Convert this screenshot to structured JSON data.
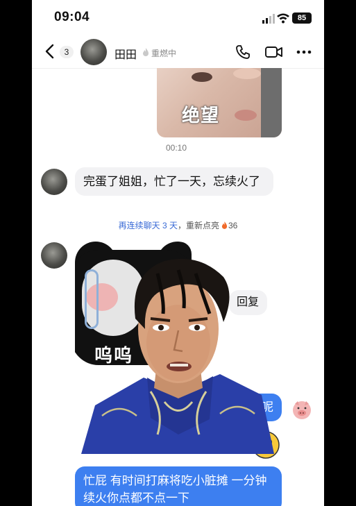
{
  "status_bar": {
    "time": "09:04",
    "battery": "85"
  },
  "header": {
    "back_count": "3",
    "contact_name": "田田",
    "streak_status": "重燃中"
  },
  "messages": {
    "sticker_top_text": "绝望",
    "voice_duration": "00:10",
    "left_message": "完蛋了姐姐，忙了一天，忘续火了",
    "notice_prefix": "再连续聊天 3 天",
    "notice_suffix": "，重新点亮",
    "notice_count": "36",
    "panda_text": "呜呜",
    "reply_text": "回复",
    "right_message_1": "火呢",
    "right_message_2": "忙屁 有时间打麻将吃小脏摊 一分钟续火你点都不点一下"
  },
  "colors": {
    "accent": "#3d7ff0",
    "notice_blue": "#3a6bd6",
    "flame": "#f06a2a"
  }
}
